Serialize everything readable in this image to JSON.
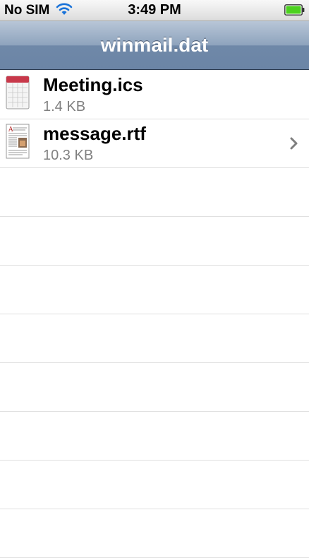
{
  "status_bar": {
    "carrier": "No SIM",
    "time": "3:49 PM",
    "wifi_icon": "wifi-icon",
    "battery_icon": "battery-icon",
    "battery_color": "#4cd11f"
  },
  "nav_bar": {
    "title": "winmail.dat"
  },
  "files": [
    {
      "name": "Meeting.ics",
      "size": "1.4 KB",
      "icon": "calendar-icon",
      "has_disclosure": false
    },
    {
      "name": "message.rtf",
      "size": "10.3 KB",
      "icon": "document-icon",
      "has_disclosure": true
    }
  ],
  "colors": {
    "nav_accent": "#6f88a8",
    "separator": "#e0e0e0",
    "subtitle": "#808080"
  }
}
